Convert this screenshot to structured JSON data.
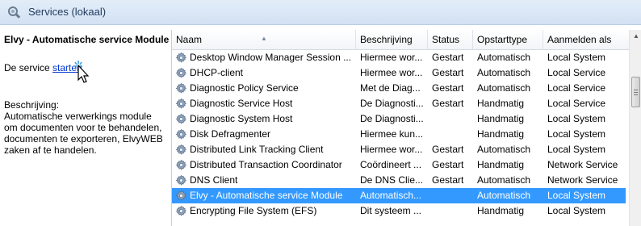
{
  "window": {
    "title": "Services (lokaal)"
  },
  "details": {
    "service_name": "Elvy - Automatische service Module",
    "start_prefix": "De service ",
    "start_link": "starten",
    "description_label": "Beschrijving:",
    "description_text": "Automatische verwerkings module om documenten voor te behandelen, documenten te exporteren, ElvyWEB zaken af te handelen."
  },
  "columns": {
    "name": "Naam",
    "description": "Beschrijving",
    "status": "Status",
    "startup": "Opstarttype",
    "logon": "Aanmelden als"
  },
  "services": [
    {
      "name": "Desktop Window Manager Session ...",
      "description": "Hiermee wor...",
      "status": "Gestart",
      "startup": "Automatisch",
      "logon": "Local System"
    },
    {
      "name": "DHCP-client",
      "description": "Hiermee wor...",
      "status": "Gestart",
      "startup": "Automatisch",
      "logon": "Local Service"
    },
    {
      "name": "Diagnostic Policy Service",
      "description": "Met de Diag...",
      "status": "Gestart",
      "startup": "Automatisch",
      "logon": "Local Service"
    },
    {
      "name": "Diagnostic Service Host",
      "description": "De Diagnosti...",
      "status": "Gestart",
      "startup": "Handmatig",
      "logon": "Local Service"
    },
    {
      "name": "Diagnostic System Host",
      "description": "De Diagnosti...",
      "status": "",
      "startup": "Handmatig",
      "logon": "Local System"
    },
    {
      "name": "Disk Defragmenter",
      "description": "Hiermee kun...",
      "status": "",
      "startup": "Handmatig",
      "logon": "Local System"
    },
    {
      "name": "Distributed Link Tracking Client",
      "description": "Hiermee wor...",
      "status": "Gestart",
      "startup": "Automatisch",
      "logon": "Local System"
    },
    {
      "name": "Distributed Transaction Coordinator",
      "description": "Coördineert ...",
      "status": "Gestart",
      "startup": "Handmatig",
      "logon": "Network Service"
    },
    {
      "name": "DNS Client",
      "description": "De DNS Clie...",
      "status": "Gestart",
      "startup": "Automatisch",
      "logon": "Network Service"
    },
    {
      "name": "Elvy - Automatische service Module",
      "description": "Automatisch...",
      "status": "",
      "startup": "Automatisch",
      "logon": "Local System",
      "selected": true
    },
    {
      "name": "Encrypting File System (EFS)",
      "description": "Dit systeem ...",
      "status": "",
      "startup": "Handmatig",
      "logon": "Local System"
    }
  ],
  "colors": {
    "selection": "#3399ff",
    "link": "#0033cc",
    "title_text": "#1e395b"
  }
}
